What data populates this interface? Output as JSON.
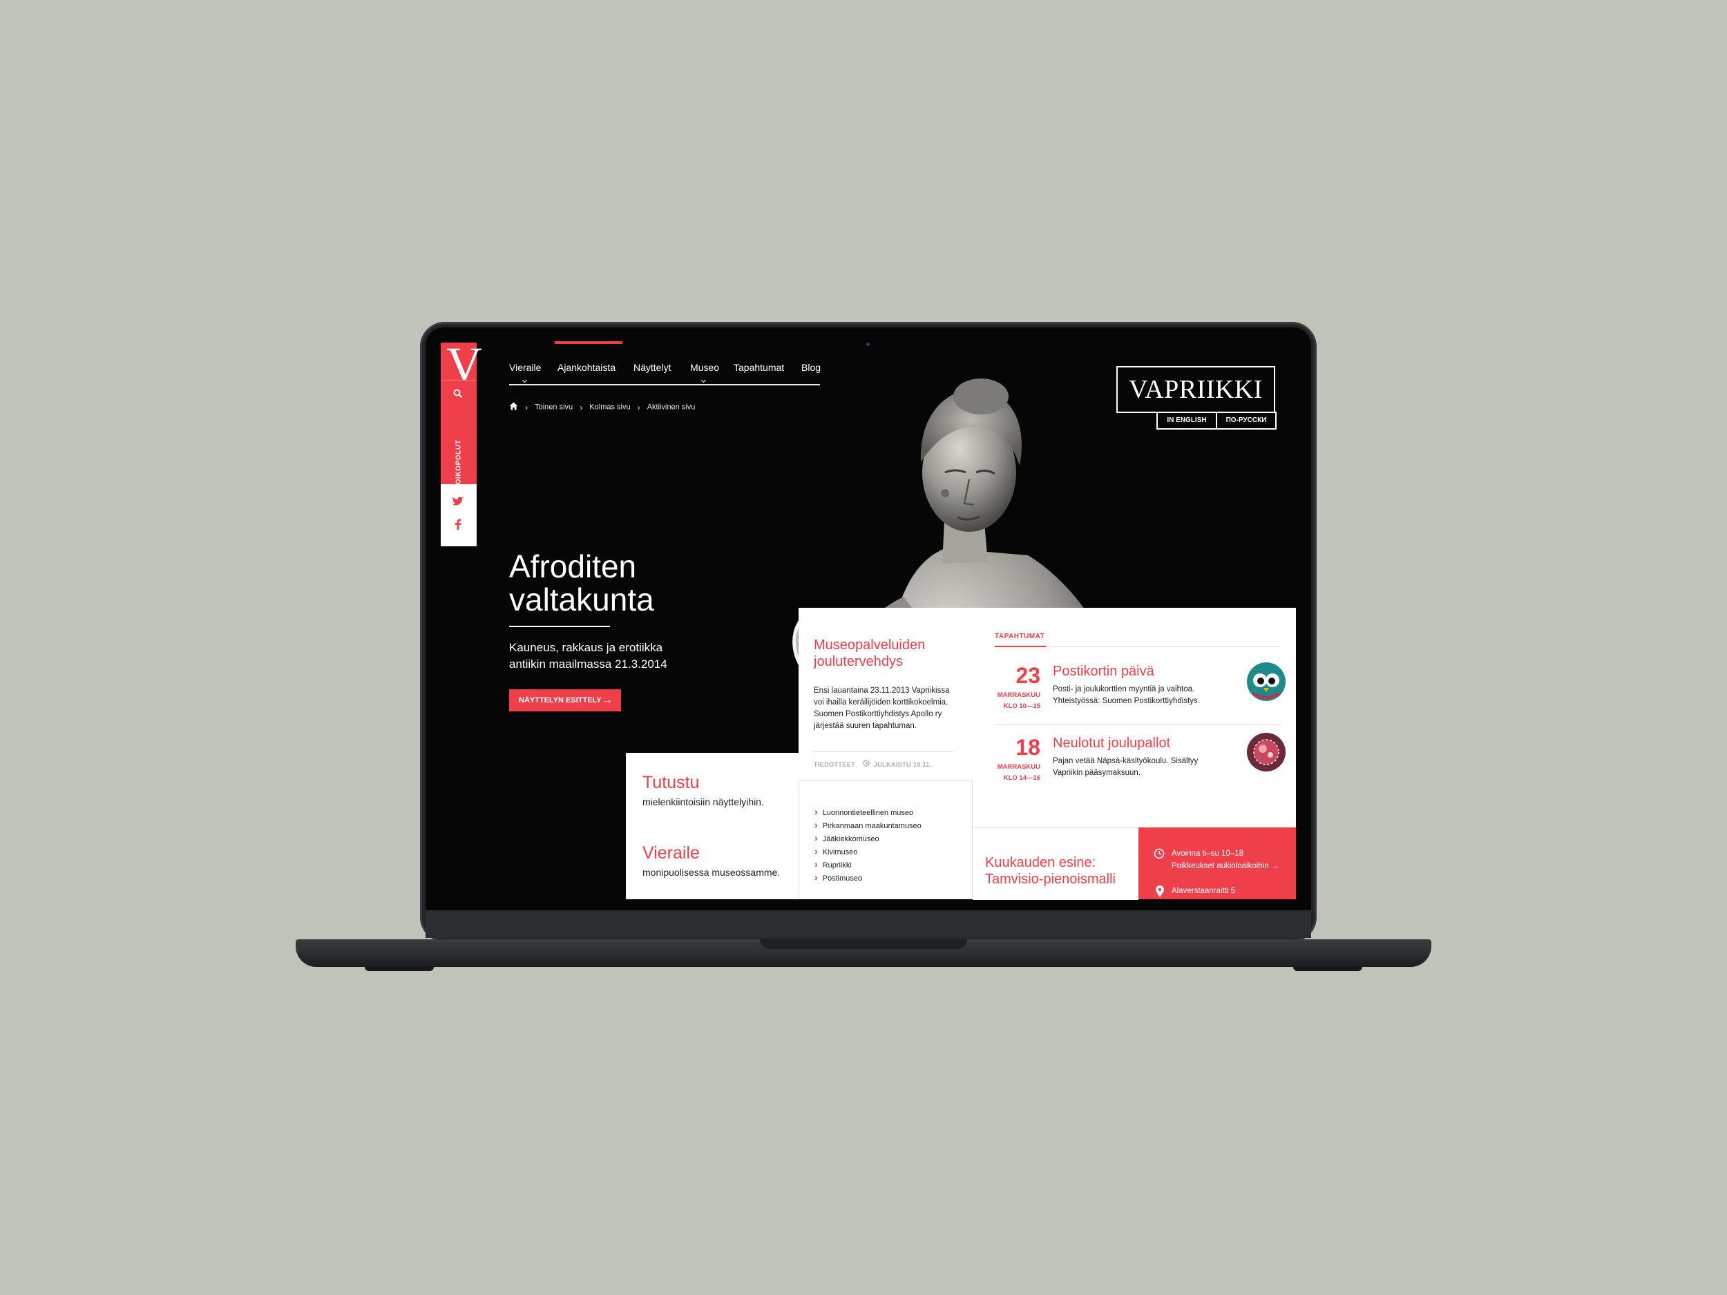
{
  "sidebar": {
    "logo": "V",
    "vertical_label": "OIKOPOLUT"
  },
  "nav": {
    "items": [
      {
        "label": "Vieraile"
      },
      {
        "label": "Ajankohtaista"
      },
      {
        "label": "Näyttelyt"
      },
      {
        "label": "Museo"
      },
      {
        "label": "Tapahtumat"
      },
      {
        "label": "Blog"
      }
    ],
    "active_index": 1
  },
  "breadcrumb": [
    "Toinen sivu",
    "Kolmas sivu",
    "Aktiivinen sivu"
  ],
  "brand": {
    "name": "VAPRIIKKI",
    "lang_en": "IN ENGLISH",
    "lang_ru": "ПО-РУССКИ"
  },
  "hero": {
    "title": "Afroditen valtakunta",
    "subtitle": "Kauneus, rakkaus ja erotiikka antiikin maailmassa 21.3.2014",
    "button": "NÄYTTELYN ESITTELY",
    "button_arrow": "→"
  },
  "news": {
    "title": "Museopalveluiden joulutervehdys",
    "text": "Ensi lauantaina 23.11.2013 Vapriikissa voi ihailla keräilijöiden korttikokoelmia. Suomen Postikorttiyhdistys Apollo ry järjestää suuren tapahtuman.",
    "meta_category": "TIEDOTTEET",
    "meta_date": "JULKAISTU 19.11."
  },
  "events": {
    "heading": "TAPAHTUMAT",
    "items": [
      {
        "day": "23",
        "month": "MARRASKUU",
        "time": "KLO 10—15",
        "title": "Postikortin päivä",
        "desc": "Posti- ja joulukorttien myyntiä ja vaihtoa. Yhteistyössä: Suomen Postikorttiyhdistys."
      },
      {
        "day": "18",
        "month": "MARRASKUU",
        "time": "KLO 14—16",
        "title": "Neulotut joulupallot",
        "desc": "Pajan vetää Näpsä-käsityökoulu. Sisältyy Vapriikin pääsymaksuun."
      }
    ]
  },
  "tutustu": {
    "title": "Tutustu",
    "subtitle": "mielenkiintoisiin näyttelyihin."
  },
  "vieraile": {
    "title": "Vieraile",
    "subtitle": "monipuolisessa museossamme."
  },
  "museum_links": [
    "Luonnontieteellinen museo",
    "Pirkanmaan maakuntamuseo",
    "Jääkiekkomuseo",
    "Kivimuseo",
    "Rupriikki",
    "Postimuseo"
  ],
  "object_of_month": {
    "title": "Kuukauden esine: Tamvisio-pienoismalli"
  },
  "info": {
    "hours": "Avoinna ti–su 10–18",
    "exceptions": "Poikkeukset aukioloaikoihin →",
    "address": "Alaverstaanraitti 5"
  },
  "colors": {
    "accent": "#ef3f4b",
    "background": "#060606",
    "page_bg": "#c0c3b9"
  },
  "icons": [
    "search-icon",
    "twitter-icon",
    "facebook-icon",
    "home-icon",
    "clock-icon",
    "location-pin-icon",
    "chevron-down-icon"
  ]
}
